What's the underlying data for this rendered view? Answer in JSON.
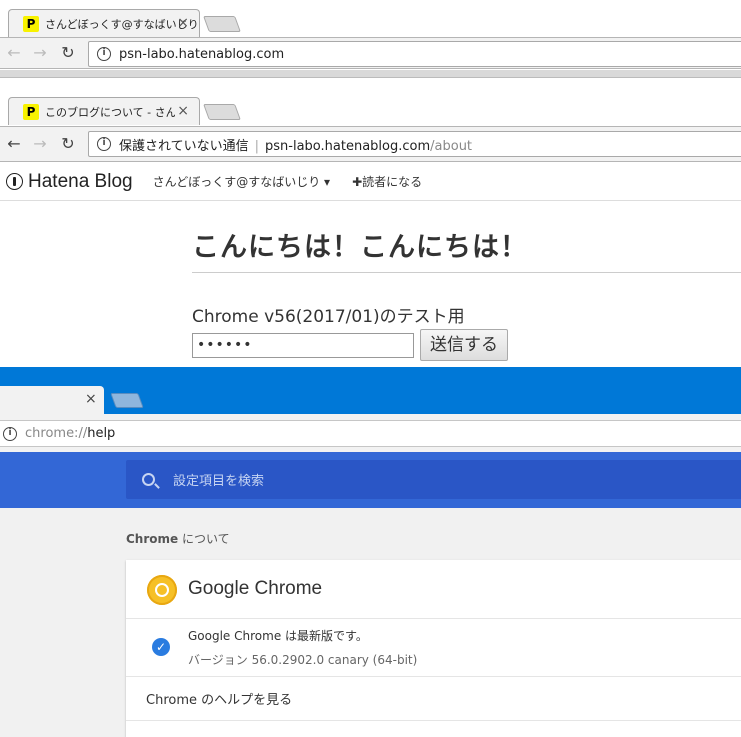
{
  "window1": {
    "tab_title": "さんどぼっくす@すなばいじり",
    "tab_close": "×",
    "url": "psn-labo.hatenablog.com"
  },
  "window2": {
    "tab_title": "このブログについて - さんどぼ",
    "tab_close": "×",
    "security_text": "保護されていない通信",
    "url_host": "psn-labo.hatenablog.com",
    "url_path": "/about"
  },
  "hatena": {
    "logo_text": "Hatena Blog",
    "blog_name": "さんどぼっくす@すなばいじり ▾",
    "subscribe": "✚読者になる",
    "title": "こんにちは！こんにちは！",
    "body_text": "Chrome v56(2017/01)のテスト用",
    "password_value": "••••••",
    "submit_label": "送信する"
  },
  "canary": {
    "tab_close": "×",
    "url_scheme": "chrome://",
    "url_page": "help",
    "search_placeholder": "設定項目を検索",
    "about_label_bold": "Chrome",
    "about_label_rest": " について",
    "product_name": "Google Chrome",
    "status_text": "Google Chrome は最新版です。",
    "version_text": "バージョン 56.0.2902.0 canary (64-bit)",
    "help_link": "Chrome のヘルプを見る",
    "next_item": "..."
  },
  "icons": {
    "back": "←",
    "forward": "→",
    "reload": "↻",
    "info": "i",
    "check": "✓",
    "favicon": "P"
  },
  "colors": {
    "canary_frame": "#0078d7",
    "settings_header": "#3367d6",
    "favicon_bg": "#f8f200"
  }
}
